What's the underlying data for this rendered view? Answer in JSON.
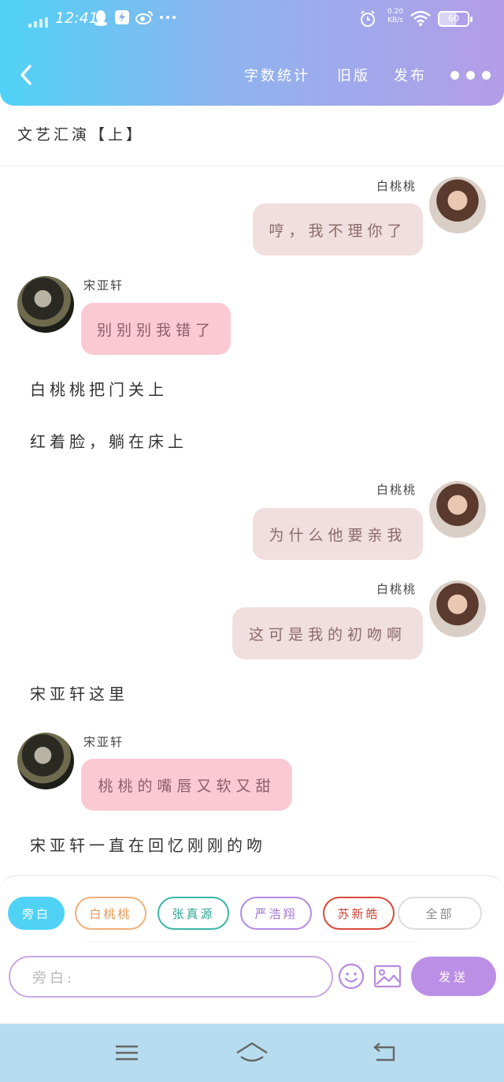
{
  "status": {
    "time": "12:41",
    "speed_top": "0.20",
    "speed_unit": "KB/s",
    "battery": "60"
  },
  "nav": {
    "stats": "字数统计",
    "old": "旧版",
    "publish": "发布"
  },
  "chapter_title": "文艺汇演【上】",
  "chat": {
    "m1": {
      "name": "白桃桃",
      "text": "哼，我不理你了"
    },
    "m2": {
      "name": "宋亚轩",
      "text": "别别别我错了"
    },
    "n1": "白桃桃把门关上",
    "n2": "红着脸，躺在床上",
    "m3": {
      "name": "白桃桃",
      "text": "为什么他要亲我"
    },
    "m4": {
      "name": "白桃桃",
      "text": "这可是我的初吻啊"
    },
    "n3": "宋亚轩这里",
    "m5": {
      "name": "宋亚轩",
      "text": "桃桃的嘴唇又软又甜"
    },
    "n4": "宋亚轩一直在回忆刚刚的吻"
  },
  "chips": [
    "旁白",
    "白桃桃",
    "张真源",
    "严浩翔",
    "苏新皓",
    "全部"
  ],
  "chip_colors": [
    "#4fd2f6",
    "#f0b07a",
    "#3ab7a8",
    "#b58be0",
    "#d94a3c",
    "#dcdcdc"
  ],
  "input_placeholder": "旁白:",
  "send_label": "发送",
  "colors": {
    "accent": "#4fd2f6",
    "purple": "#bc8fe6"
  }
}
